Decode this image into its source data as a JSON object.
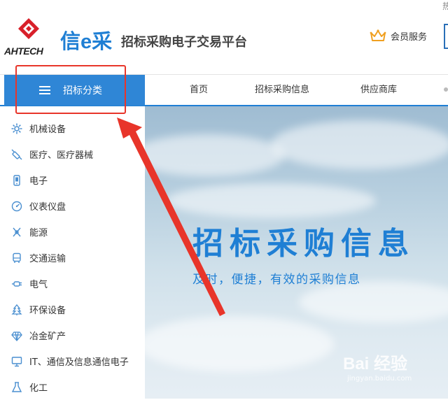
{
  "header": {
    "logo_text": "AHTECH",
    "brand": "信e采",
    "tagline": "招标采购电子交易平台",
    "member_label": "会员服务",
    "corner_char": "热"
  },
  "nav": {
    "category_label": "招标分类",
    "items": [
      "首页",
      "招标采购信息",
      "供应商库"
    ]
  },
  "sidebar": {
    "items": [
      {
        "label": "机械设备",
        "icon": "gear-icon"
      },
      {
        "label": "医疗、医疗器械",
        "icon": "syringe-icon"
      },
      {
        "label": "电子",
        "icon": "phone-icon"
      },
      {
        "label": "仪表仪盘",
        "icon": "gauge-icon"
      },
      {
        "label": "能源",
        "icon": "energy-icon"
      },
      {
        "label": "交通运输",
        "icon": "bus-icon"
      },
      {
        "label": "电气",
        "icon": "plug-icon"
      },
      {
        "label": "环保设备",
        "icon": "tree-icon"
      },
      {
        "label": "冶金矿产",
        "icon": "diamond-icon"
      },
      {
        "label": "IT、通信及信息通信电子",
        "icon": "monitor-icon"
      },
      {
        "label": "化工",
        "icon": "flask-icon"
      }
    ]
  },
  "banner": {
    "title": "招标采购信息",
    "subtitle": "及时，便捷，有效的采购信息"
  },
  "watermark": {
    "text": "Bai 经验",
    "sub": "jingyan.baidu.com"
  },
  "colors": {
    "accent": "#1f7fd4",
    "category_bg": "#2f86d6",
    "annotation": "#e8352a"
  }
}
